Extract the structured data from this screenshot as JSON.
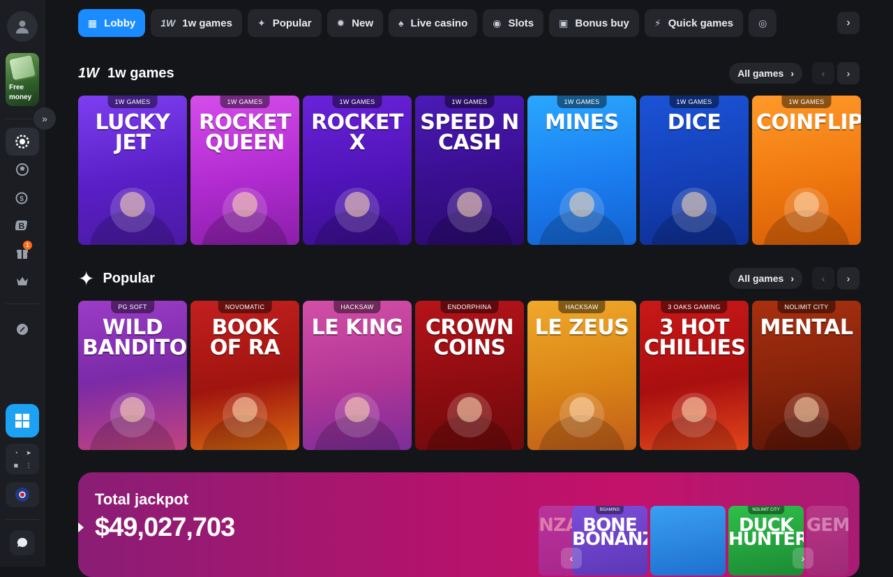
{
  "sidebar": {
    "free_money": "Free money",
    "notification_count": "1",
    "social": [
      "◔",
      "➤",
      "◙",
      "⋮"
    ]
  },
  "nav": {
    "tabs": [
      {
        "label": "Lobby",
        "icon": "grid-icon",
        "glyph": "▦",
        "active": true
      },
      {
        "label": "1w games",
        "icon": "1w-logo-icon",
        "glyph": "1W",
        "active": false
      },
      {
        "label": "Popular",
        "icon": "sparkle-icon",
        "glyph": "✦",
        "active": false
      },
      {
        "label": "New",
        "icon": "new-badge-icon",
        "glyph": "✹",
        "active": false
      },
      {
        "label": "Live casino",
        "icon": "spade-icon",
        "glyph": "♠",
        "active": false
      },
      {
        "label": "Slots",
        "icon": "slot-machine-icon",
        "glyph": "◉",
        "active": false
      },
      {
        "label": "Bonus buy",
        "icon": "gift-icon",
        "glyph": "▣",
        "active": false
      },
      {
        "label": "Quick games",
        "icon": "lightning-icon",
        "glyph": "⚡",
        "active": false
      }
    ]
  },
  "sections": {
    "w1": {
      "icon_text": "1W",
      "title": "1w games",
      "all_label": "All games",
      "games": [
        {
          "provider": "1W GAMES",
          "title": "LUCKY JET",
          "bg": "linear-gradient(170deg,#7d3ff0,#5a1fc7 55%,#4a1aa3)"
        },
        {
          "provider": "1W GAMES",
          "title": "ROCKET QUEEN",
          "bg": "linear-gradient(170deg,#d54dea,#b12bd0 55%,#8a1fa9)"
        },
        {
          "provider": "1W GAMES",
          "title": "ROCKET X",
          "bg": "linear-gradient(170deg,#6a22d9,#4f14b8 55%,#3b0e8e)"
        },
        {
          "provider": "1W GAMES",
          "title": "SPEED N CASH",
          "bg": "linear-gradient(170deg,#4b1bb6,#3a0f92 50%,#2a0a6e)"
        },
        {
          "provider": "1W GAMES",
          "title": "MINES",
          "bg": "linear-gradient(170deg,#2aa7ff,#1b7ef0 55%,#1362d1)"
        },
        {
          "provider": "1W GAMES",
          "title": "DICE",
          "bg": "linear-gradient(170deg,#1b53d6,#1440b8 55%,#0f2f93)"
        },
        {
          "provider": "1W GAMES",
          "title": "COINFLIP",
          "bg": "linear-gradient(170deg,#ff9a2a,#f0780f 55%,#d85e06)"
        }
      ]
    },
    "popular": {
      "icon_text": "✦",
      "title": "Popular",
      "all_label": "All games",
      "games": [
        {
          "provider": "PG SOFT",
          "title": "WILD BANDITO",
          "bg": "linear-gradient(170deg,#9b3cc6,#7b2aa8 50%,#c2447e)"
        },
        {
          "provider": "NOVOMATIC",
          "title": "BOOK OF RA",
          "bg": "linear-gradient(170deg,#c2201f,#a0140f 55%,#d86a10)"
        },
        {
          "provider": "HACKSAW",
          "title": "LE KING",
          "bg": "linear-gradient(170deg,#d24fa6,#b23596 55%,#7c2d9a)"
        },
        {
          "provider": "ENDORPHINA",
          "title": "CROWN COINS",
          "bg": "linear-gradient(170deg,#b5141a,#8e0c10 55%,#6e0a0c)"
        },
        {
          "provider": "HACKSAW",
          "title": "LE ZEUS",
          "bg": "linear-gradient(170deg,#f0a82a,#d98416 55%,#c25d1a)"
        },
        {
          "provider": "3 OAKS GAMING",
          "title": "3 HOT CHILLIES",
          "bg": "linear-gradient(170deg,#c81818,#a90f0f 55%,#e0461a)"
        },
        {
          "provider": "NOLIMIT CITY",
          "title": "MENTAL",
          "bg": "linear-gradient(170deg,#a8300f,#84220a 55%,#5a1506)"
        }
      ]
    }
  },
  "jackpot": {
    "label": "Total jackpot",
    "amount": "$49,027,703",
    "mini_games": [
      {
        "provider": "",
        "title": "NZA ON",
        "bg": "linear-gradient(170deg,#b45fd6,#8f3bb5)"
      },
      {
        "provider": "BGAMING",
        "title": "BONE BONANZA",
        "bg": "linear-gradient(170deg,#7b4dd8,#5d37b7)"
      },
      {
        "provider": "",
        "title": "",
        "bg": "linear-gradient(170deg,#3aa0f0,#1e6fd0)"
      },
      {
        "provider": "NOLIMIT CITY",
        "title": "DUCK HUNTERS",
        "bg": "linear-gradient(170deg,#2fbf4a,#1b8a33)"
      },
      {
        "provider": "",
        "title": "GEM",
        "bg": "linear-gradient(170deg,#c25fa0,#933a7c)"
      }
    ]
  }
}
